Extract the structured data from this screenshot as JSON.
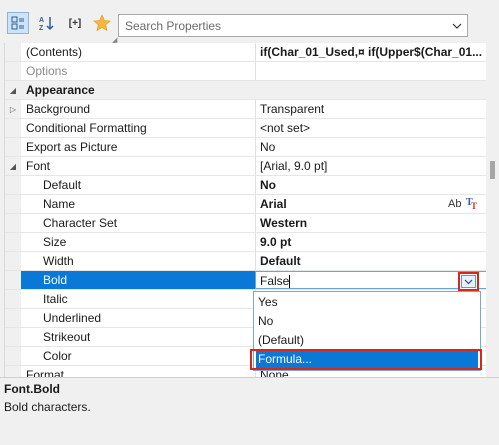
{
  "toolbar": {
    "categorized_icon": "categorized-view-icon",
    "alphabetical_icon": "alphabetical-sort-icon",
    "expand_icon": "expand-all-icon",
    "expand_label": "[+]",
    "favorites_icon": "star-icon",
    "search_placeholder": "Search Properties",
    "search_dropdown_icon": "chevron-down-icon"
  },
  "rows": [
    {
      "name": "(Contents)",
      "value": "if(Char_01_Used,¤  if(Upper$(Char_01..."
    },
    {
      "name": "Options",
      "value": ""
    },
    {
      "name": "Appearance",
      "value": ""
    },
    {
      "name": "Background",
      "value": "Transparent"
    },
    {
      "name": "Conditional Formatting",
      "value": "<not set>"
    },
    {
      "name": "Export as Picture",
      "value": "No"
    },
    {
      "name": "Font",
      "value": "[Arial, 9.0 pt]"
    },
    {
      "name": "Default",
      "value": "No"
    },
    {
      "name": "Name",
      "value": "Arial",
      "extra": "Ab"
    },
    {
      "name": "Character Set",
      "value": "Western"
    },
    {
      "name": "Size",
      "value": "9.0 pt"
    },
    {
      "name": "Width",
      "value": "Default"
    },
    {
      "name": "Bold",
      "value": "False"
    },
    {
      "name": "Italic",
      "value": ""
    },
    {
      "name": "Underlined",
      "value": ""
    },
    {
      "name": "Strikeout",
      "value": ""
    },
    {
      "name": "Color",
      "value": ""
    },
    {
      "name": "Format",
      "value": "None"
    }
  ],
  "dropdown": {
    "options": [
      "Yes",
      "No",
      "(Default)",
      "Formula..."
    ],
    "highlighted_option": "Formula..."
  },
  "description": {
    "title": "Font.Bold",
    "text": "Bold characters."
  },
  "colors": {
    "selection": "#0a78d7",
    "callout": "#d9261c"
  }
}
